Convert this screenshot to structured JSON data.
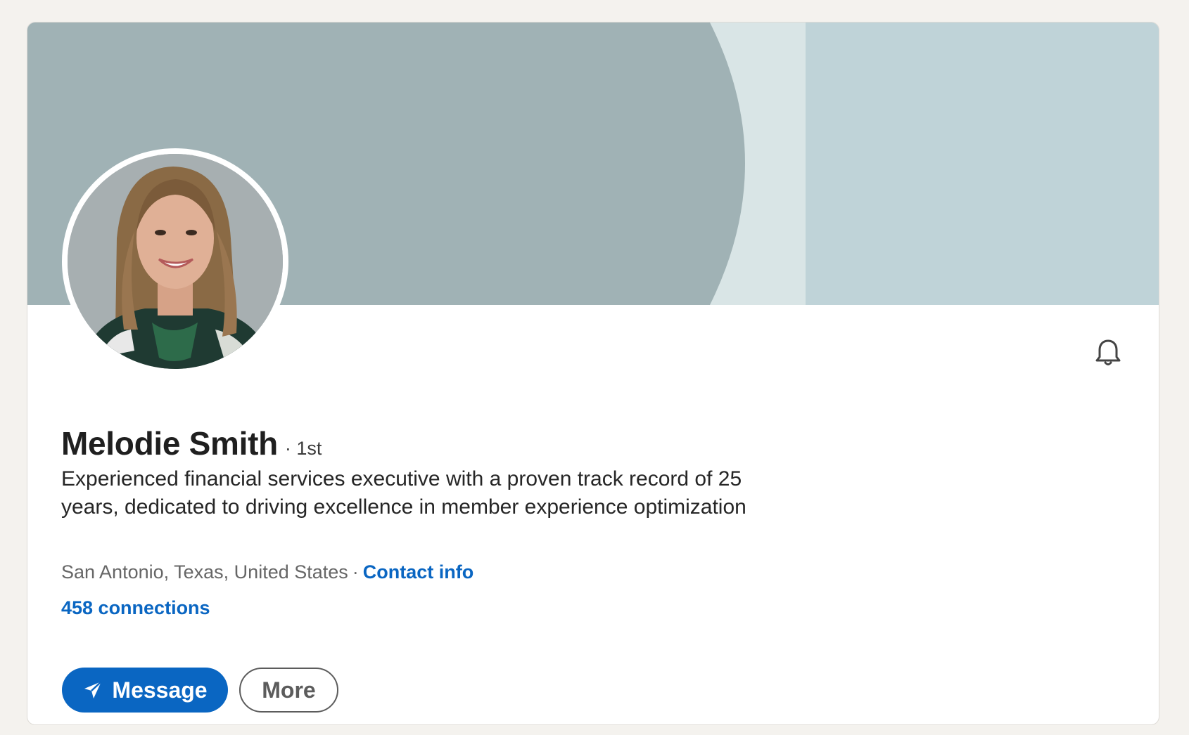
{
  "profile": {
    "name": "Melodie Smith",
    "degree": "· 1st",
    "headline": "Experienced financial services executive with a proven track record of 25 years, dedicated to driving excellence in member experience optimization",
    "location": "San Antonio, Texas, United States",
    "separator": "·",
    "contact_info_label": "Contact info",
    "connections_label": "458 connections"
  },
  "actions": {
    "message_label": "Message",
    "more_label": "More"
  },
  "icons": {
    "message": "send-icon",
    "notifications": "bell-icon"
  },
  "colors": {
    "accent": "#0a66c2",
    "banner_dark": "#a0b2b5",
    "banner_light": "#bfd3d8",
    "banner_strip": "#d9e5e6",
    "page_background": "#f4f2ee"
  }
}
